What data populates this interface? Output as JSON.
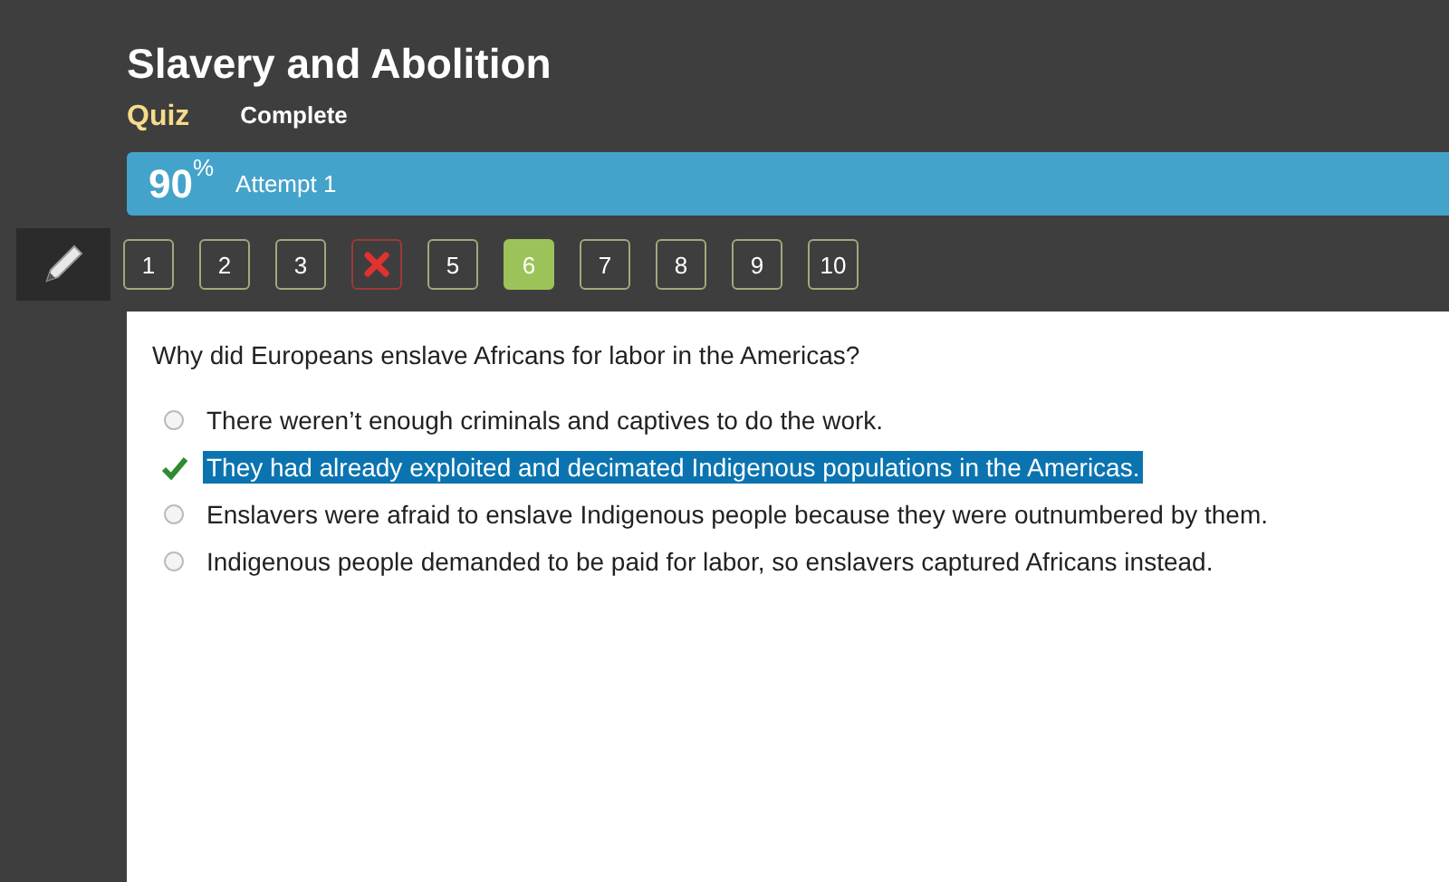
{
  "title": "Slavery and Abolition",
  "tabs": [
    {
      "label": "Quiz",
      "selected": true
    },
    {
      "label": "Complete",
      "selected": false
    }
  ],
  "score": {
    "value": "90$^{%}$",
    "attempt": "Attempt 1"
  },
  "questions": [
    {
      "kind": "number",
      "label": "1",
      "selected": false
    },
    {
      "kind": "number",
      "label": "2",
      "selected": false
    },
    {
      "kind": "number",
      "label": "3",
      "selected": false
    },
    {
      "kind": "incorrect",
      "selected": false
    },
    {
      "kind": "number",
      "label": "5",
      "selected": false
    },
    {
      "kind": "number",
      "label": "6",
      "selected": true
    },
    {
      "kind": "number",
      "label": "7",
      "selected": false
    },
    {
      "kind": "number",
      "label": "8",
      "selected": false
    },
    {
      "kind": "number",
      "label": "9",
      "selected": false
    },
    {
      "kind": "number",
      "label": "10",
      "selected": false
    }
  ],
  "question": "Why did Europeans enslave Africans for labor in the Americas?",
  "answers": [
    {
      "text": "There weren’t enough criminals and captives to do the work.",
      "selected": false
    },
    {
      "text": "They had already exploited and decimated Indigenous populations in the Americas.",
      "selected": true
    },
    {
      "text": "Enslavers were afraid to enslave Indigenous people because they were outnumbered by them.",
      "selected": false
    },
    {
      "text": "Indigenous people demanded to be paid for labor, so enslavers captured Africans instead.",
      "selected": false
    }
  ]
}
